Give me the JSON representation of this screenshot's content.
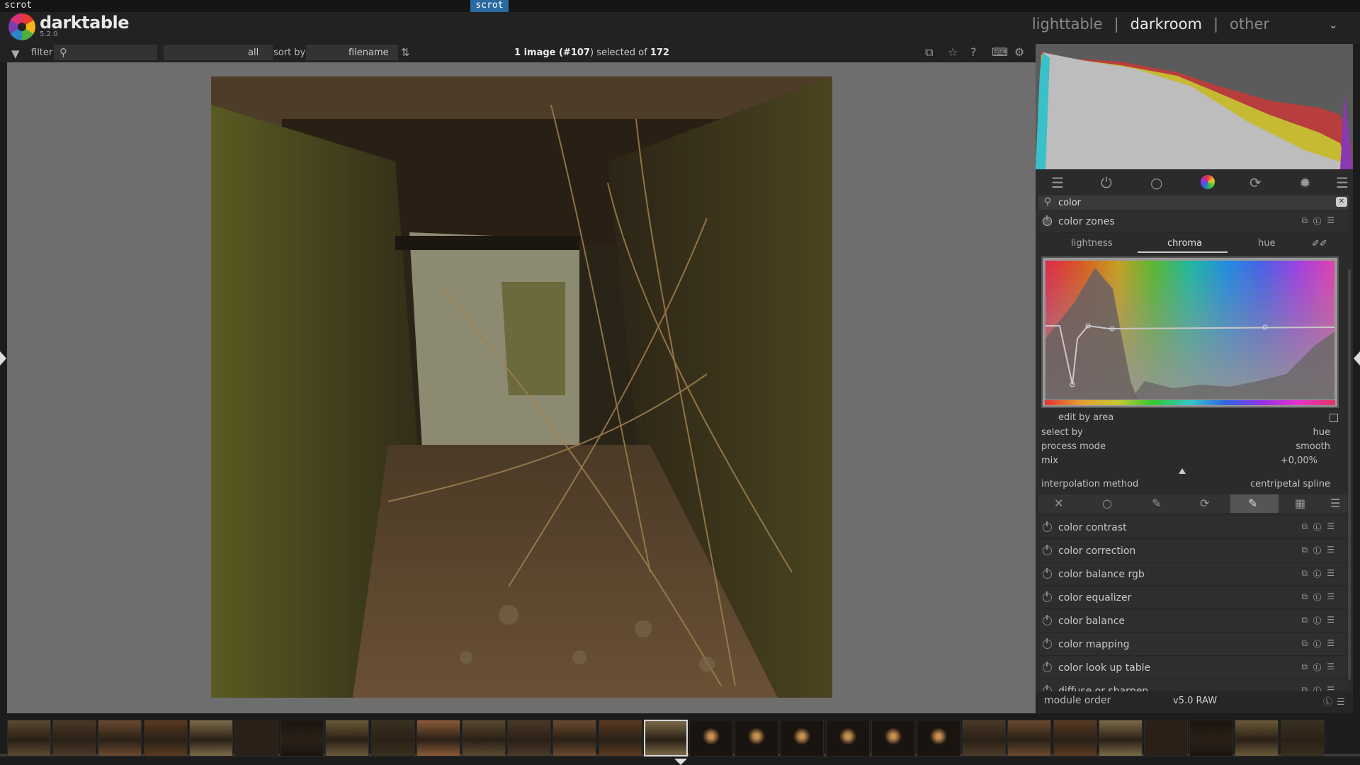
{
  "system": {
    "left_text": "scrot",
    "tag": "scrot"
  },
  "app": {
    "name": "darktable",
    "version": "5.2.0"
  },
  "views": {
    "lighttable": "lighttable",
    "separator": "|",
    "darkroom": "darkroom",
    "other": "other",
    "menu_icon": "chevron-down-icon"
  },
  "toolbar": {
    "filter_label": "filter",
    "search_placeholder": "",
    "filter_value": "all",
    "sortby_label": "sort by",
    "sort_value": "filename",
    "count_prefix": "1 image (#",
    "count_id": "107",
    "count_mid": ") selected of ",
    "count_total": "172",
    "icons": [
      "grouping-icon",
      "star-icon",
      "help-icon",
      "keyboard-icon",
      "gear-icon"
    ]
  },
  "colors": {
    "accent": "#d8d8d8",
    "panel": "#2b2b2b",
    "center_bg": "#6e6e6e",
    "status_tag": "#2a6aa0"
  },
  "right_panel": {
    "search_text": "color",
    "module_groups": [
      "quick-access-icon",
      "active-modules-icon",
      "base-icon",
      "color-icon",
      "correct-icon",
      "effect-icon",
      "presets-icon"
    ],
    "color_zones": {
      "title": "color zones",
      "tabs": [
        "lightness",
        "chroma",
        "hue"
      ],
      "active_tab": "chroma",
      "edit_by_area": "edit by area",
      "select_by_label": "select by",
      "select_by_value": "hue",
      "process_mode_label": "process mode",
      "process_mode_value": "smooth",
      "mix_label": "mix",
      "mix_value": "+0,00%",
      "mix_level": 0.5,
      "interpolation_label": "interpolation method",
      "interpolation_value": "centripetal spline"
    },
    "modules": [
      "color contrast",
      "color correction",
      "color balance rgb",
      "color equalizer",
      "color balance",
      "color mapping",
      "color look up table",
      "diffuse or sharpen"
    ],
    "module_order_label": "module order",
    "module_order_value": "v5.0 RAW"
  },
  "filmstrip": {
    "count": 29,
    "selected_index": 14
  }
}
